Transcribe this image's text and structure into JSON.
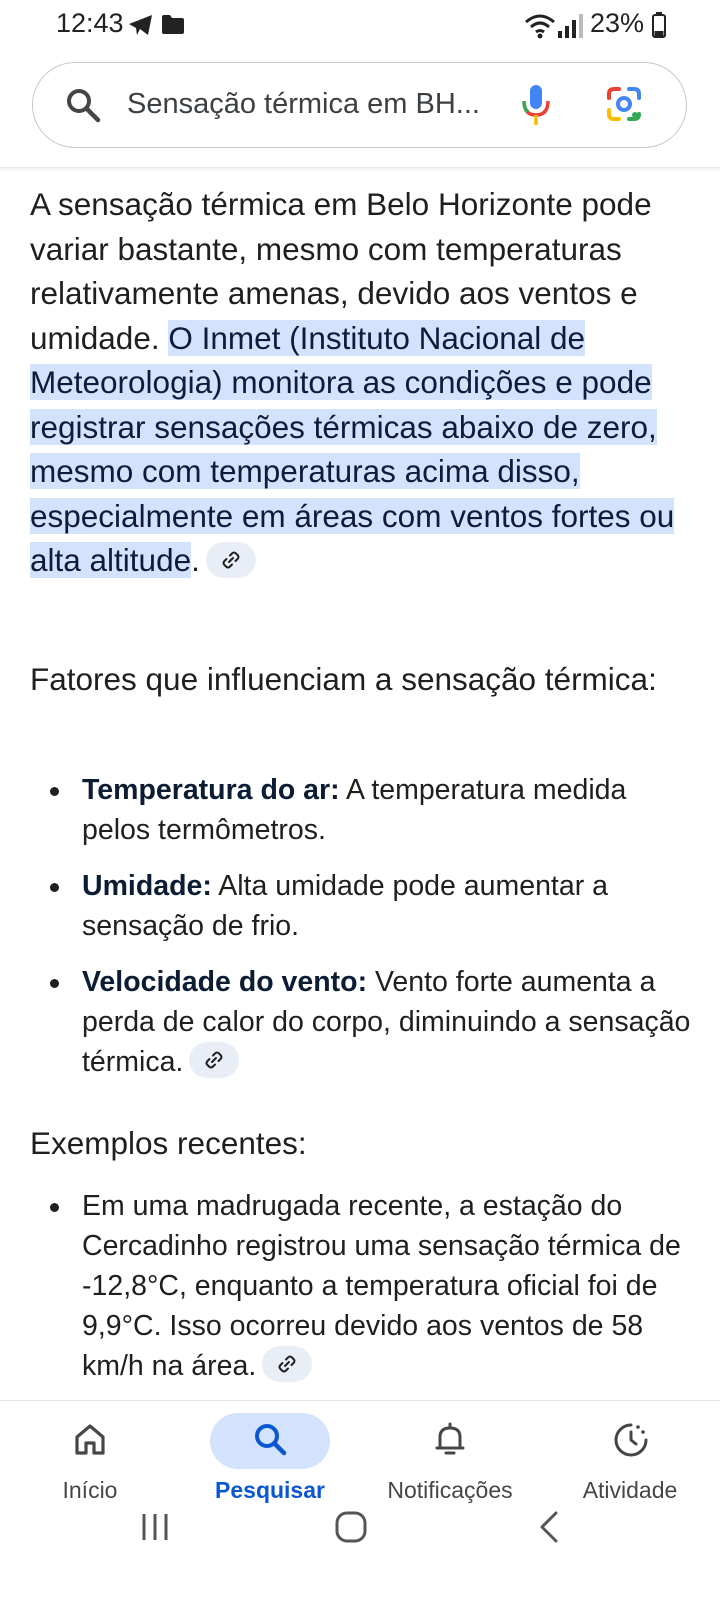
{
  "status_bar": {
    "time": "12:43",
    "battery_percent": "23%",
    "icons": [
      "telegram-icon",
      "folder-icon",
      "wifi-icon",
      "signal-icon",
      "battery-icon"
    ]
  },
  "search": {
    "query": "Sensação térmica em BH...",
    "icons": [
      "search-icon",
      "mic-icon",
      "google-lens-icon"
    ]
  },
  "answer": {
    "intro_plain": "A sensação térmica em Belo Horizonte pode variar bastante, mesmo com temperaturas relativamente amenas, devido aos ventos e umidade. ",
    "intro_highlight": "O Inmet (Instituto Nacional de Meteorologia) monitora as condições e pode registrar sensações térmicas abaixo de zero, mesmo com temperaturas acima disso, especialmente em áreas com ventos fortes ou alta altitude",
    "intro_end": "."
  },
  "factors": {
    "heading": "Fatores que influenciam a sensação térmica:",
    "items": [
      {
        "term": "Temperatura do ar:",
        "text": " A temperatura medida pelos termômetros."
      },
      {
        "term": "Umidade:",
        "text": " Alta umidade pode aumentar a sensação de frio."
      },
      {
        "term": "Velocidade do vento:",
        "text": " Vento forte aumenta a perda de calor do corpo, diminuindo a sensação térmica."
      }
    ]
  },
  "examples": {
    "heading": "Exemplos recentes:",
    "items": [
      {
        "text": "Em uma madrugada recente, a estação do Cercadinho registrou uma sensação térmica de -12,8°C, enquanto a temperatura oficial foi de 9,9°C. Isso ocorreu devido aos ventos de 58 km/h na área."
      }
    ]
  },
  "bottom_nav": {
    "items": [
      {
        "label": "Início",
        "icon": "home-icon",
        "active": false
      },
      {
        "label": "Pesquisar",
        "icon": "search-icon",
        "active": true
      },
      {
        "label": "Notificações",
        "icon": "bell-icon",
        "active": false
      },
      {
        "label": "Atividade",
        "icon": "activity-icon",
        "active": false
      }
    ],
    "active_color": "#0b57d0",
    "active_pill_color": "#d3e3fd"
  },
  "system_nav": {
    "icons": [
      "recents-icon",
      "home-button-icon",
      "back-icon"
    ]
  },
  "colors": {
    "highlight": "#d3e3fd",
    "link_chip": "#e9eef6"
  }
}
